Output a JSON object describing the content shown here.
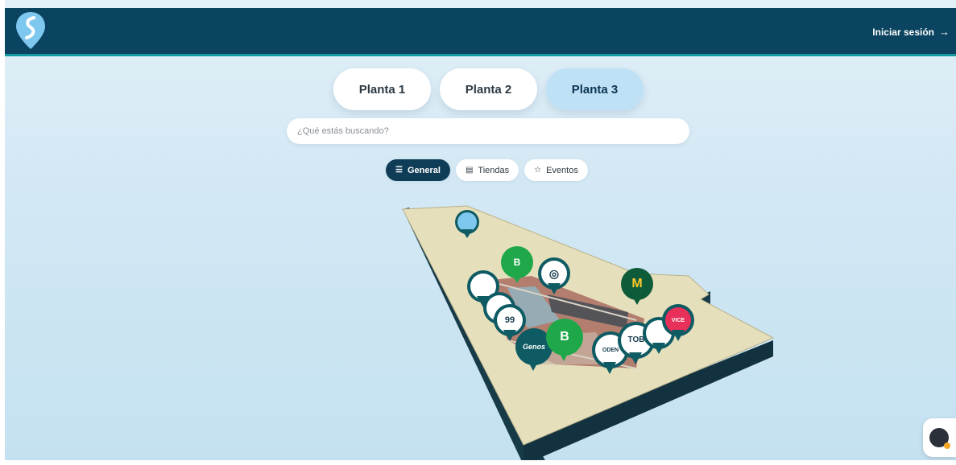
{
  "header": {
    "login_label": "Iniciar sesión",
    "login_arrow": "→",
    "logo_icon": "map-pin-road-logo"
  },
  "floors": [
    {
      "label": "Planta 1",
      "active": false
    },
    {
      "label": "Planta 2",
      "active": false
    },
    {
      "label": "Planta 3",
      "active": true
    }
  ],
  "search": {
    "placeholder": "¿Qué estás buscando?",
    "value": ""
  },
  "filters": [
    {
      "label": "General",
      "icon": "list-filter-icon",
      "glyph": "☰",
      "active": true
    },
    {
      "label": "Tiendas",
      "icon": "store-icon",
      "glyph": "▤",
      "active": false
    },
    {
      "label": "Eventos",
      "icon": "calendar-star-icon",
      "glyph": "☆",
      "active": false
    }
  ],
  "map_pins": [
    {
      "name": "you-are-here",
      "text": ""
    },
    {
      "name": "pharmacy",
      "text": "B"
    },
    {
      "name": "shop-emblem",
      "text": "◎"
    },
    {
      "name": "mcdonalds",
      "text": "M"
    },
    {
      "name": "shop-left-1",
      "text": ""
    },
    {
      "name": "shop-left-2",
      "text": ""
    },
    {
      "name": "shop-99",
      "text": "99"
    },
    {
      "name": "genos",
      "text": "Genos"
    },
    {
      "name": "pharmacy-large",
      "text": "B"
    },
    {
      "name": "oden",
      "text": "ODEN"
    },
    {
      "name": "tob",
      "text": "TOB"
    },
    {
      "name": "shop-right",
      "text": ""
    },
    {
      "name": "vice",
      "text": "VICE"
    }
  ],
  "colors": {
    "header_bg": "#0b4460",
    "accent": "#139aa3",
    "active_floor": "#bfe1f6",
    "active_chip": "#0f3d57",
    "mcdonalds": "#0e5b3a",
    "pharmacy": "#1fa84a",
    "vice": "#e8305a"
  }
}
